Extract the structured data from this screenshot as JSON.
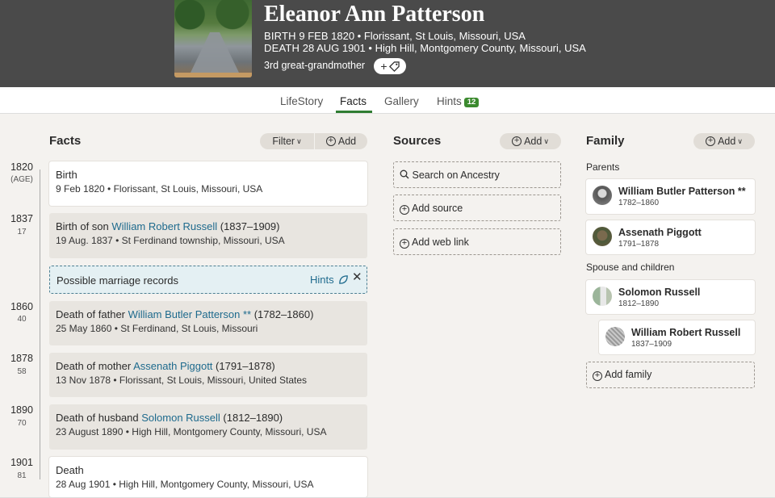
{
  "person": {
    "name": "Eleanor Ann Patterson",
    "birth_label": "BIRTH",
    "birth_value": "9 FEB 1820 • Florissant, St Louis, Missouri, USA",
    "death_label": "DEATH",
    "death_value": "28 AUG 1901 • High Hill, Montgomery County, Missouri, USA",
    "relationship": "3rd great-grandmother",
    "tag_button": "+"
  },
  "tabs": [
    {
      "label": "LifeStory"
    },
    {
      "label": "Facts"
    },
    {
      "label": "Gallery"
    },
    {
      "label": "Hints",
      "badge": "12"
    }
  ],
  "facts_section": {
    "title": "Facts",
    "filter_label": "Filter",
    "add_label": "Add"
  },
  "timeline": [
    {
      "year": "1820",
      "age": "(AGE)"
    },
    {
      "year": "1837",
      "age": "17"
    },
    {
      "year": "1860",
      "age": "40"
    },
    {
      "year": "1878",
      "age": "58"
    },
    {
      "year": "1890",
      "age": "70"
    },
    {
      "year": "1901",
      "age": "81"
    }
  ],
  "facts": [
    {
      "title": "Birth",
      "detail": "9 Feb 1820 • Florissant, St Louis, Missouri, USA"
    },
    {
      "title_prefix": "Birth of son ",
      "link": "William Robert Russell",
      "title_suffix": " (1837–1909)",
      "detail": "19 Aug. 1837 • St Ferdinand township, Missouri, USA"
    },
    {
      "title_prefix": "Death of father ",
      "link": "William Butler Patterson **",
      "title_suffix": " (1782–1860)",
      "detail": "25 May 1860 • St Ferdinand, St Louis, Missouri"
    },
    {
      "title_prefix": "Death of mother ",
      "link": "Assenath Piggott",
      "title_suffix": " (1791–1878)",
      "detail": "13 Nov 1878 • Florissant, St Louis, Missouri, United States"
    },
    {
      "title_prefix": "Death of husband ",
      "link": "Solomon Russell",
      "title_suffix": " (1812–1890)",
      "detail": "23 August 1890 • High Hill, Montgomery County, Missouri, USA"
    },
    {
      "title": "Death",
      "detail": "28 Aug 1901 • High Hill, Montgomery County, Missouri, USA"
    }
  ],
  "hint": {
    "text": "Possible marriage records",
    "link": "Hints",
    "close": "✕"
  },
  "sources": {
    "title": "Sources",
    "add_label": "Add",
    "items": [
      "Search on Ancestry",
      "Add source",
      "Add web link"
    ]
  },
  "family": {
    "title": "Family",
    "add_label": "Add",
    "parents_label": "Parents",
    "spouse_label": "Spouse and children",
    "parents": [
      {
        "name": "William Butler Patterson **",
        "dates": "1782–1860"
      },
      {
        "name": "Assenath Piggott",
        "dates": "1791–1878"
      }
    ],
    "spouse": {
      "name": "Solomon Russell",
      "dates": "1812–1890"
    },
    "child": {
      "name": "William Robert Russell",
      "dates": "1837–1909"
    },
    "add_family_label": "Add family"
  }
}
